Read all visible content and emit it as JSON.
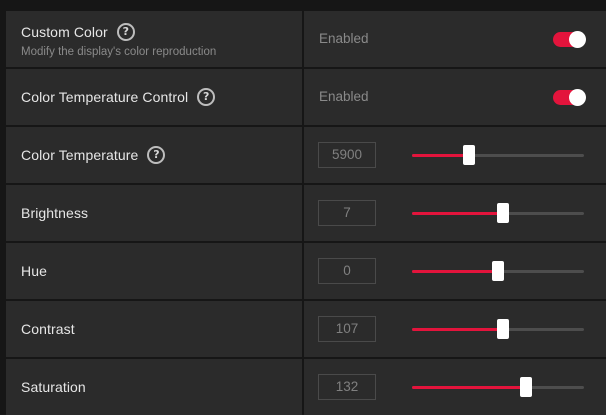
{
  "accent_color": "#e3143c",
  "rows": [
    {
      "id": "custom-color",
      "label": "Custom Color",
      "sublabel": "Modify the display's color reproduction",
      "help": "?",
      "status": "Enabled",
      "toggle_on": true
    },
    {
      "id": "color-temperature-control",
      "label": "Color Temperature Control",
      "help": "?",
      "status": "Enabled",
      "toggle_on": true
    },
    {
      "id": "color-temperature",
      "label": "Color Temperature",
      "help": "?",
      "value": "5900",
      "slider_fraction": 0.33
    },
    {
      "id": "brightness",
      "label": "Brightness",
      "value": "7",
      "slider_fraction": 0.53
    },
    {
      "id": "hue",
      "label": "Hue",
      "value": "0",
      "slider_fraction": 0.5
    },
    {
      "id": "contrast",
      "label": "Contrast",
      "value": "107",
      "slider_fraction": 0.53
    },
    {
      "id": "saturation",
      "label": "Saturation",
      "value": "132",
      "slider_fraction": 0.66
    }
  ]
}
